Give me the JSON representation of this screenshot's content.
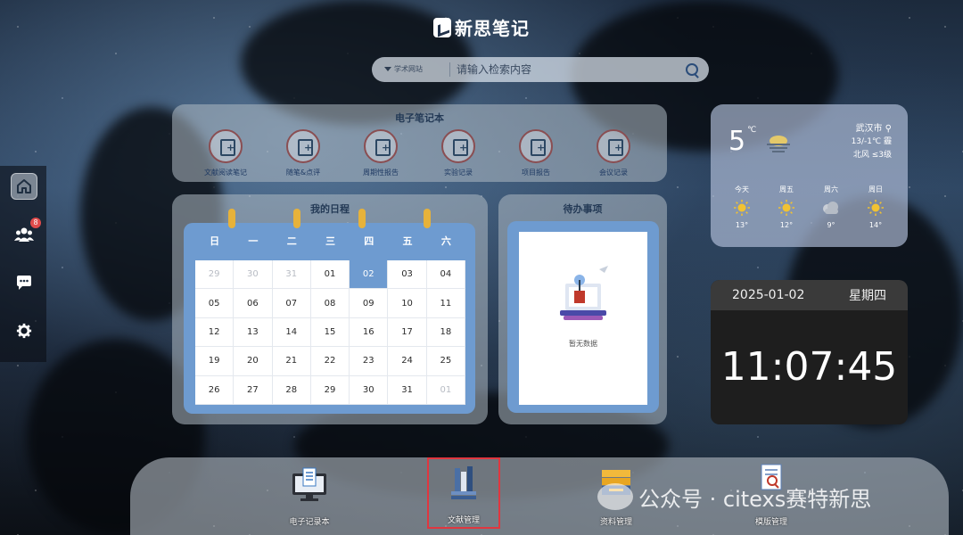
{
  "app": {
    "title": "新思笔记"
  },
  "search": {
    "category": "学术网站",
    "placeholder": "请输入检索内容"
  },
  "sidebar": {
    "items": [
      {
        "icon": "home-icon",
        "active": true
      },
      {
        "icon": "team-icon",
        "badge": "8"
      },
      {
        "icon": "chat-icon"
      },
      {
        "icon": "gear-icon"
      }
    ]
  },
  "notebook": {
    "title": "电子笔记本",
    "items": [
      {
        "label": "文献阅读笔记"
      },
      {
        "label": "随笔&点评"
      },
      {
        "label": "周期性报告"
      },
      {
        "label": "实验记录"
      },
      {
        "label": "项目报告"
      },
      {
        "label": "会议记录"
      }
    ]
  },
  "schedule": {
    "title": "我的日程",
    "weekdays": [
      "日",
      "一",
      "二",
      "三",
      "四",
      "五",
      "六"
    ],
    "days": [
      {
        "d": "29",
        "muted": true
      },
      {
        "d": "30",
        "muted": true
      },
      {
        "d": "31",
        "muted": true
      },
      {
        "d": "01"
      },
      {
        "d": "02",
        "today": true
      },
      {
        "d": "03"
      },
      {
        "d": "04"
      },
      {
        "d": "05"
      },
      {
        "d": "06"
      },
      {
        "d": "07"
      },
      {
        "d": "08"
      },
      {
        "d": "09"
      },
      {
        "d": "10"
      },
      {
        "d": "11"
      },
      {
        "d": "12"
      },
      {
        "d": "13"
      },
      {
        "d": "14"
      },
      {
        "d": "15"
      },
      {
        "d": "16"
      },
      {
        "d": "17"
      },
      {
        "d": "18"
      },
      {
        "d": "19"
      },
      {
        "d": "20"
      },
      {
        "d": "21"
      },
      {
        "d": "22"
      },
      {
        "d": "23"
      },
      {
        "d": "24"
      },
      {
        "d": "25"
      },
      {
        "d": "26"
      },
      {
        "d": "27"
      },
      {
        "d": "28"
      },
      {
        "d": "29"
      },
      {
        "d": "30"
      },
      {
        "d": "31"
      },
      {
        "d": "01",
        "muted": true
      }
    ]
  },
  "todo": {
    "title": "待办事项",
    "empty": "暂无数据"
  },
  "weather": {
    "temp": "5",
    "unit": "℃",
    "city": "武汉市",
    "range": "13/-1℃ 霾",
    "wind": "北风 ≤3级",
    "forecast": [
      {
        "day": "今天",
        "temp": "13°",
        "icon": "sun-icon"
      },
      {
        "day": "周五",
        "temp": "12°",
        "icon": "sun-icon"
      },
      {
        "day": "周六",
        "temp": "9°",
        "icon": "cloud-icon"
      },
      {
        "day": "周日",
        "temp": "14°",
        "icon": "sun-icon"
      }
    ]
  },
  "clock": {
    "date": "2025-01-02",
    "weekday": "星期四",
    "time": "11:07:45"
  },
  "dock": {
    "items": [
      {
        "label": "电子记录本",
        "icon": "monitor-document-icon"
      },
      {
        "label": "文献管理",
        "icon": "books-icon",
        "selected": true
      },
      {
        "label": "资料管理",
        "icon": "folder-icon"
      },
      {
        "label": "模版管理",
        "icon": "template-icon"
      }
    ]
  },
  "watermark": {
    "text": "公众号 · citexs赛特新思"
  },
  "colors": {
    "accent": "#6e9bd0",
    "ring": "#e7b23a",
    "selected_border": "#e0363f",
    "badge": "#e04b4b"
  }
}
